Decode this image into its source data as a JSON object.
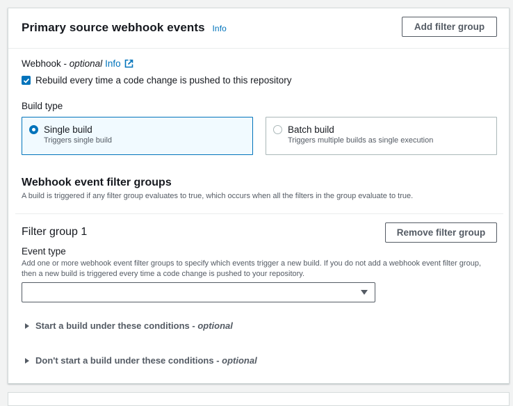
{
  "header": {
    "title": "Primary source webhook events",
    "info": "Info",
    "add_filter_group": "Add filter group"
  },
  "webhook": {
    "label": "Webhook",
    "separator": " - ",
    "optional": "optional",
    "info": "Info",
    "checkbox_label": "Rebuild every time a code change is pushed to this repository",
    "checked": true
  },
  "build_type": {
    "label": "Build type",
    "options": [
      {
        "title": "Single build",
        "description": "Triggers single build",
        "selected": true
      },
      {
        "title": "Batch build",
        "description": "Triggers multiple builds as single execution",
        "selected": false
      }
    ]
  },
  "filter_groups_section": {
    "title": "Webhook event filter groups",
    "description": "A build is triggered if any filter group evaluates to true, which occurs when all the filters in the group evaluate to true."
  },
  "filter_group": {
    "title": "Filter group 1",
    "remove_button": "Remove filter group",
    "event_type_label": "Event type",
    "event_type_description_1": "Add one or more webhook event filter groups to specify which events trigger a new build. If you do not add a webhook event filter group,",
    "event_type_description_2": "then a new build is triggered every time a code change is pushed to your repository.",
    "event_type_value": ""
  },
  "conditions": {
    "start": {
      "label": "Start a build under these conditions",
      "separator": " - ",
      "optional": "optional"
    },
    "dont_start": {
      "label": "Don't start a build under these conditions",
      "separator": " - ",
      "optional": "optional"
    }
  },
  "colors": {
    "accent": "#0073bb",
    "text": "#16191f",
    "secondary": "#545b64",
    "border": "#aab7b8"
  }
}
